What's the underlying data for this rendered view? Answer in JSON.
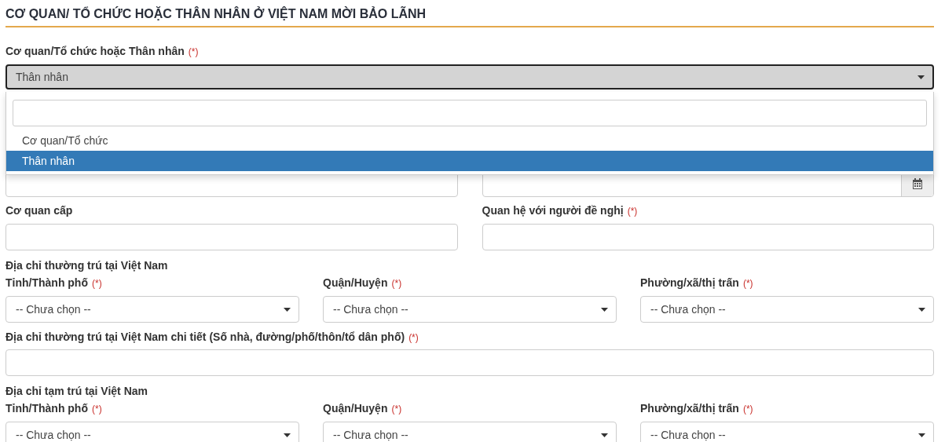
{
  "heading": "CƠ QUAN/ TỔ CHỨC HOẶC THÂN NHÂN Ở VIỆT NAM MỜI BẢO LÃNH",
  "type_field": {
    "label": "Cơ quan/Tổ chức hoặc Thân nhân",
    "required": "(*)",
    "value": "Thân nhân",
    "open": true
  },
  "dropdown_options": [
    {
      "label": "Cơ quan/Tổ chức",
      "selected": false
    },
    {
      "label": "Thân nhân",
      "selected": true
    }
  ],
  "covered_fields": [
    {
      "kind": "text"
    },
    {
      "kind": "date"
    }
  ],
  "fields_row": [
    {
      "label": "Cơ quan cấp"
    },
    {
      "label": "Quan hệ với người đề nghị",
      "required": "(*)"
    }
  ],
  "permanent_address": {
    "title": "Địa chỉ thường trú tại Việt Nam",
    "selects": [
      {
        "label": "Tỉnh/Thành phố",
        "required": "(*)",
        "value": "-- Chưa chọn --"
      },
      {
        "label": "Quận/Huyện",
        "required": "(*)",
        "value": "-- Chưa chọn --"
      },
      {
        "label": "Phường/xã/thị trấn",
        "required": "(*)",
        "value": "-- Chưa chọn --"
      }
    ],
    "detail": {
      "label": "Địa chỉ thường trú tại Việt Nam chi tiết (Số nhà, đường/phố/thôn/tổ dân phố)",
      "required": "(*)"
    }
  },
  "temporary_address": {
    "title": "Địa chỉ tạm trú tại Việt Nam",
    "selects": [
      {
        "label": "Tỉnh/Thành phố",
        "required": "(*)",
        "value": "-- Chưa chọn --"
      },
      {
        "label": "Quận/Huyện",
        "required": "(*)",
        "value": "-- Chưa chọn --"
      },
      {
        "label": "Phường/xã/thị trấn",
        "required": "(*)",
        "value": "-- Chưa chọn --"
      }
    ]
  }
}
